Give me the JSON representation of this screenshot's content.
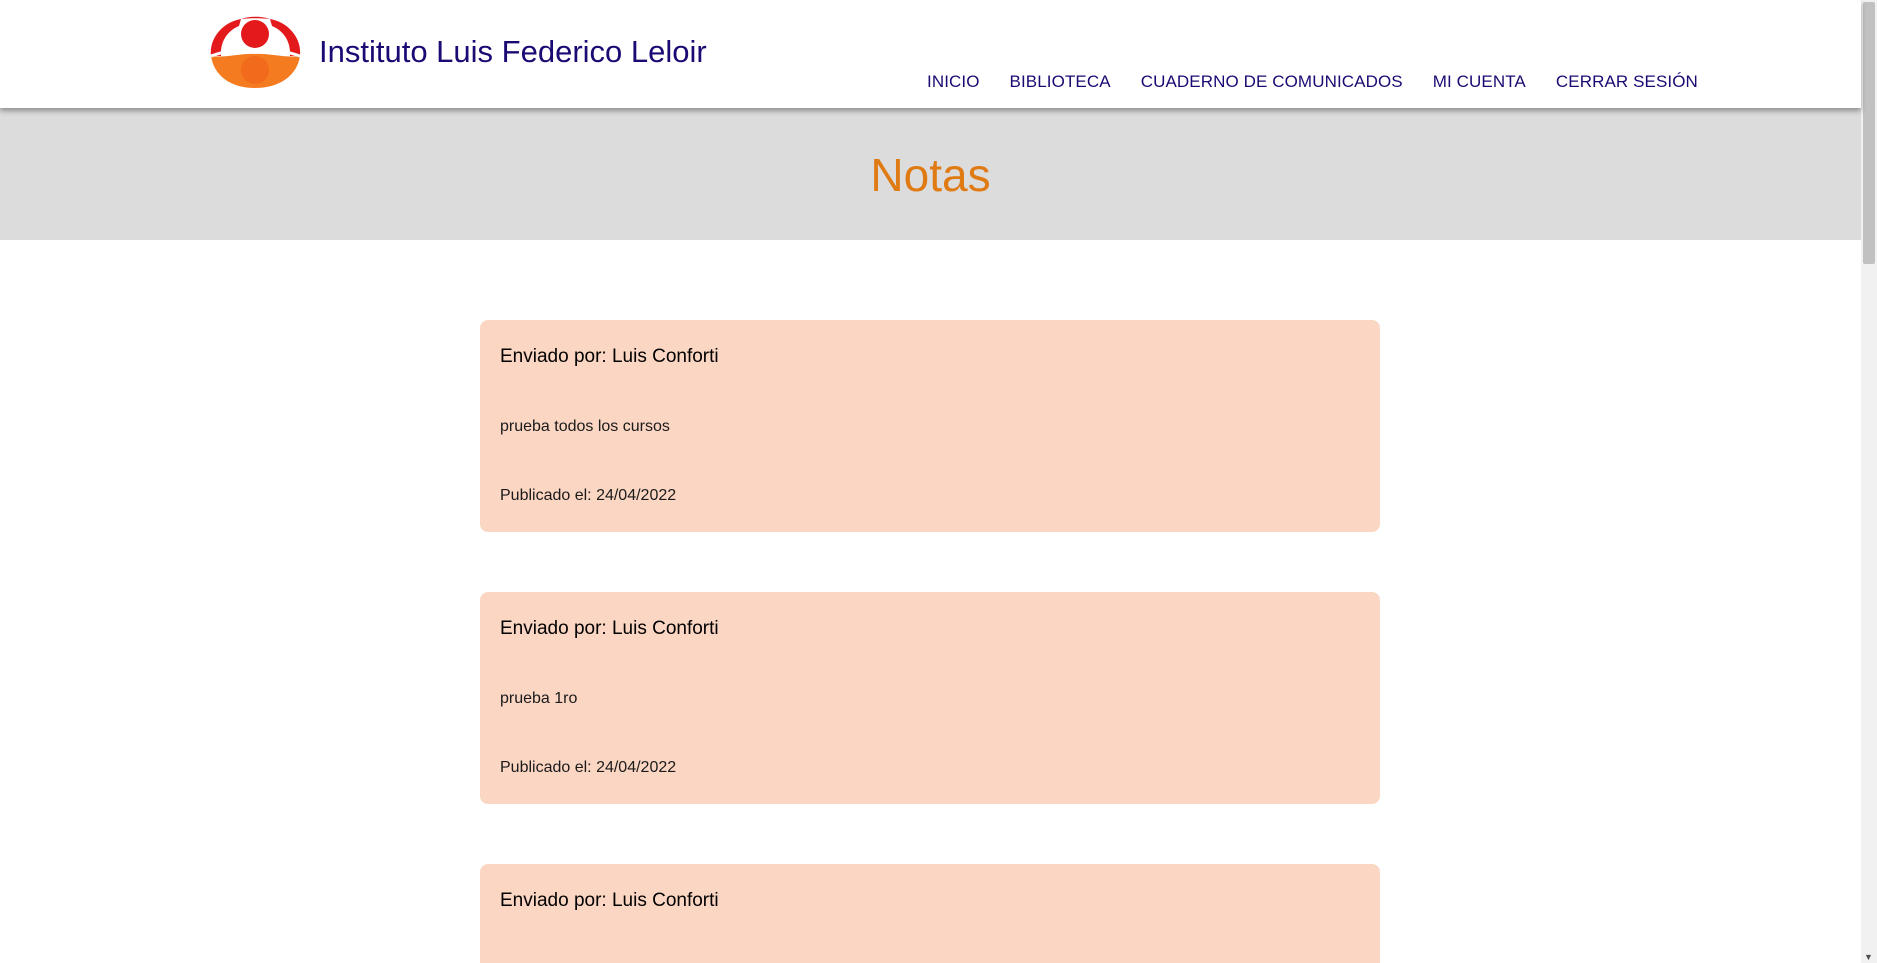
{
  "header": {
    "site_title": "Instituto Luis Federico Leloir",
    "logo_icon": "institute-logo-icon",
    "nav": [
      {
        "label": "INICIO"
      },
      {
        "label": "BIBLIOTECA"
      },
      {
        "label": "CUADERNO DE COMUNICADOS"
      },
      {
        "label": "MI CUENTA"
      },
      {
        "label": "CERRAR SESIÓN"
      }
    ]
  },
  "hero": {
    "title": "Notas"
  },
  "notes": [
    {
      "sender": "Enviado por: Luis Conforti",
      "body": "prueba todos los cursos",
      "date": "Publicado el: 24/04/2022"
    },
    {
      "sender": "Enviado por: Luis Conforti",
      "body": "prueba 1ro",
      "date": "Publicado el: 24/04/2022"
    },
    {
      "sender": "Enviado por: Luis Conforti"
    }
  ],
  "colors": {
    "brand_text": "#1a0a73",
    "accent_orange": "#e07a12",
    "note_background": "#fbd6c3",
    "hero_background": "#dcdcdc"
  }
}
